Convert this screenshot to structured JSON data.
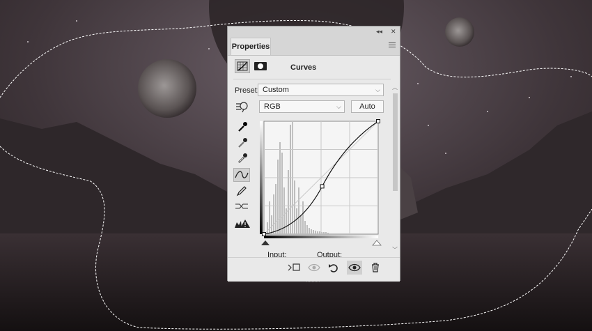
{
  "panel": {
    "tab_label": "Properties",
    "collapse_glyph": "◂◂",
    "close_glyph": "✕",
    "adjustment_title": "Curves",
    "preset_label": "Preset:",
    "preset_value": "Custom",
    "channel_value": "RGB",
    "auto_label": "Auto",
    "input_label": "Input:",
    "output_label": "Output:"
  },
  "curve": {
    "control_points": [
      [
        0,
        0
      ],
      [
        130,
        108
      ],
      [
        255,
        255
      ]
    ],
    "input_range": [
      0,
      255
    ]
  },
  "colors": {
    "panel_bg": "#e9e9e9",
    "titlebar_bg": "#d6d6d6",
    "histogram": "#bdbdbd"
  }
}
